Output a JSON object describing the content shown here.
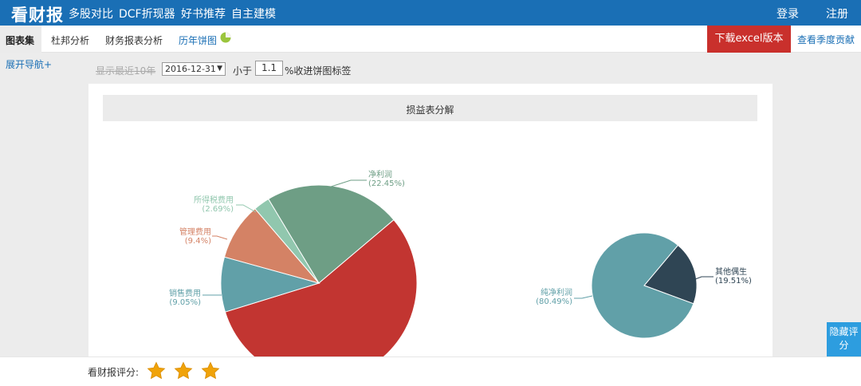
{
  "brand": "看财报",
  "nav": [
    "多股对比",
    "DCF折现器",
    "好书推荐",
    "自主建模"
  ],
  "auth": {
    "login": "登录",
    "register": "注册"
  },
  "tabs": [
    "图表集",
    "杜邦分析",
    "财务报表分析",
    "历年饼图"
  ],
  "excel_button": "下载excel版本",
  "season_link": "查看季度贡献",
  "expand_nav": "展开导航+",
  "controls": {
    "show_recent": "显示最近10年",
    "date_value": "2016-12-31",
    "less_than": "小于",
    "threshold": "1.1",
    "suffix": "%收进饼图标签"
  },
  "chart_data": [
    {
      "type": "pie",
      "title": "损益表分解",
      "slices": [
        {
          "name": "净利润",
          "value": 22.45,
          "pct_label": "(22.45%)",
          "color": "#6e9e85"
        },
        {
          "name": "",
          "value": 56.41,
          "pct_label": "",
          "color": "#c23531"
        },
        {
          "name": "销售费用",
          "value": 9.05,
          "pct_label": "(9.05%)",
          "color": "#61a0a8"
        },
        {
          "name": "管理费用",
          "value": 9.4,
          "pct_label": "(9.4%)",
          "color": "#d48265"
        },
        {
          "name": "所得税费用",
          "value": 2.69,
          "pct_label": "(2.69%)",
          "color": "#91c7ae"
        }
      ]
    },
    {
      "type": "pie",
      "slices": [
        {
          "name": "其他偶生",
          "value": 19.51,
          "pct_label": "(19.51%)",
          "color": "#2f4554"
        },
        {
          "name": "纯净利润",
          "value": 80.49,
          "pct_label": "(80.49%)",
          "color": "#61a0a8"
        }
      ]
    }
  ],
  "rating": {
    "label": "看财报评分:",
    "stars": 3,
    "star_color": "#f0a30a"
  },
  "hide_rating": "隐藏评分"
}
